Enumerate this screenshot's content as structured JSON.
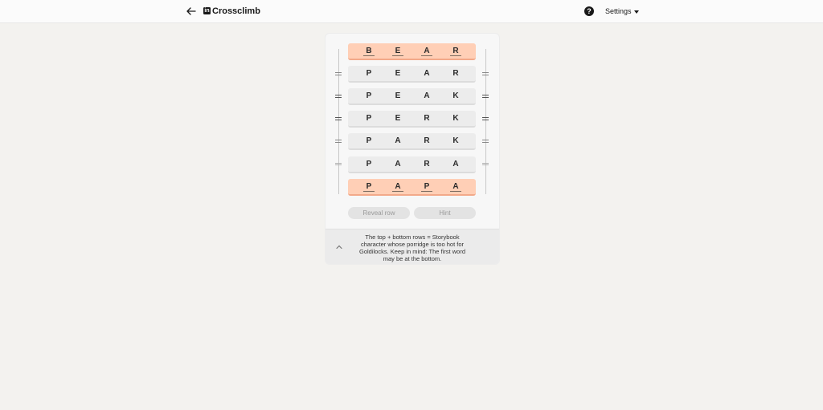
{
  "header": {
    "title": "Crossclimb",
    "logo_text": "in",
    "help_label": "?",
    "settings_label": "Settings",
    "icons": {
      "back": "arrow-left-icon",
      "help": "question-circle-icon",
      "settings_caret": "caret-down-icon"
    }
  },
  "puzzle": {
    "rows": [
      {
        "letters": [
          "B",
          "E",
          "A",
          "R"
        ],
        "highlight": true
      },
      {
        "letters": [
          "P",
          "E",
          "A",
          "R"
        ],
        "highlight": false
      },
      {
        "letters": [
          "P",
          "E",
          "A",
          "K"
        ],
        "highlight": false
      },
      {
        "letters": [
          "P",
          "E",
          "R",
          "K"
        ],
        "highlight": false
      },
      {
        "letters": [
          "P",
          "A",
          "R",
          "K"
        ],
        "highlight": false
      },
      {
        "letters": [
          "P",
          "A",
          "R",
          "A"
        ],
        "highlight": false
      },
      {
        "letters": [
          "P",
          "A",
          "P",
          "A"
        ],
        "highlight": true
      }
    ],
    "buttons": {
      "reveal_row": "Reveal row",
      "hint": "Hint"
    },
    "clue": "The top + bottom rows = Storybook character whose porridge is too hot for Goldilocks. Keep in mind: The first word may be at the bottom."
  },
  "colors": {
    "background": "#f3f2ef",
    "highlight_row": "#ffcfb6",
    "row": "#ececec",
    "disabled_button": "#e3e3e3"
  }
}
